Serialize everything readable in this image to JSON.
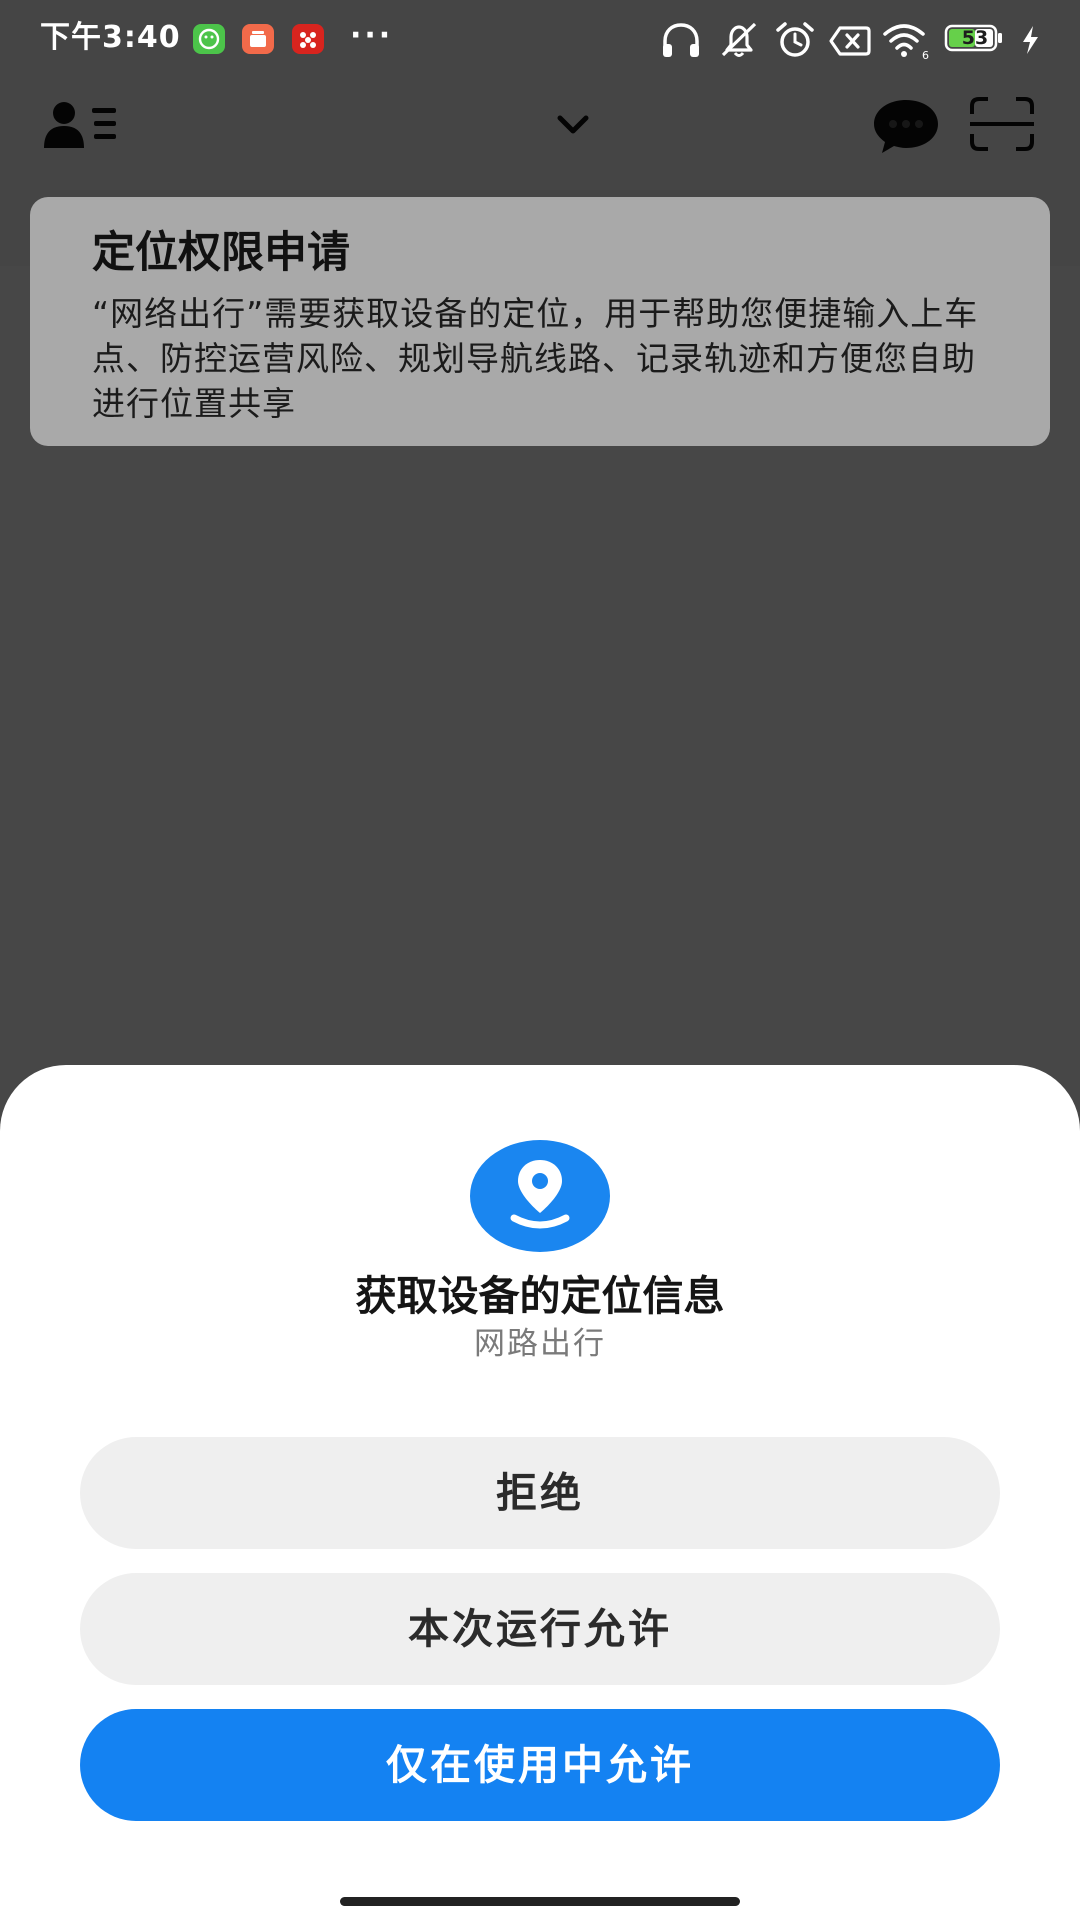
{
  "status_bar": {
    "time": "下午3:40",
    "overflow": "···",
    "battery_level": "53",
    "icons": [
      "wechat-mini-icon",
      "gift-app-icon",
      "red-app-icon",
      "headphones-icon",
      "ringer-off-icon",
      "alarm-icon",
      "sim-off-icon",
      "wifi-icon",
      "battery-icon",
      "charging-icon"
    ]
  },
  "notice": {
    "title": "定位权限申请",
    "body": "“网络出行”需要获取设备的定位，用于帮助您便捷输入上车点、防控运营风险、规划导航线路、记录轨迹和方便您自助进行位置共享"
  },
  "permission_sheet": {
    "icon": "location-pin-icon",
    "accent_color": "#1482f2",
    "title": "获取设备的定位信息",
    "app_name": "网路出行",
    "buttons": {
      "deny": "拒绝",
      "allow_once": "本次运行允许",
      "allow_while_using": "仅在使用中允许"
    }
  }
}
